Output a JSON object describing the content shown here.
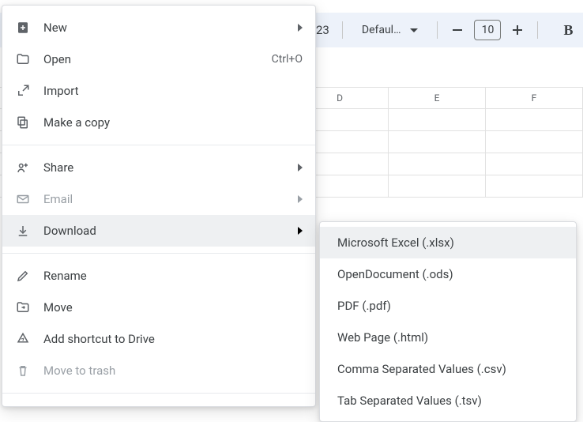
{
  "toolbar": {
    "number_fragment": "23",
    "font_name": "Defaul…",
    "font_size": "10",
    "bold": "B"
  },
  "columns": [
    "",
    "",
    "",
    "D",
    "E",
    "F"
  ],
  "menu": {
    "new": {
      "label": "New"
    },
    "open": {
      "label": "Open",
      "shortcut": "Ctrl+O"
    },
    "import": {
      "label": "Import"
    },
    "copy": {
      "label": "Make a copy"
    },
    "share": {
      "label": "Share"
    },
    "email": {
      "label": "Email"
    },
    "download": {
      "label": "Download"
    },
    "rename": {
      "label": "Rename"
    },
    "move": {
      "label": "Move"
    },
    "shortcut": {
      "label": "Add shortcut to Drive"
    },
    "trash": {
      "label": "Move to trash"
    }
  },
  "download_submenu": [
    "Microsoft Excel (.xlsx)",
    "OpenDocument (.ods)",
    "PDF (.pdf)",
    "Web Page (.html)",
    "Comma Separated Values (.csv)",
    "Tab Separated Values (.tsv)"
  ]
}
